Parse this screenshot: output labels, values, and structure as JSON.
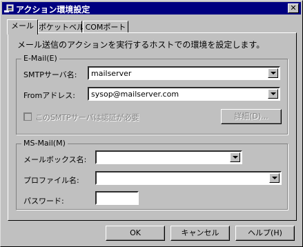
{
  "window": {
    "title": "アクション環境設定",
    "close_glyph": "✕"
  },
  "tabs": [
    {
      "label": "メール",
      "active": true
    },
    {
      "label": "ポケットベル",
      "active": false
    },
    {
      "label": "COMポート",
      "active": false
    }
  ],
  "description": "メール送信のアクションを実行するホストでの環境を設定します。",
  "email_group": {
    "legend": "E-Mail(E)",
    "smtp_label": "SMTPサーバ名:",
    "smtp_value": "mailserver",
    "from_label": "Fromアドレス:",
    "from_value": "sysop@mailserver.com",
    "auth_label": "このSMTPサーバは認証が必要",
    "auth_checked": false,
    "details_button": "詳細(D)..."
  },
  "msmail_group": {
    "legend": "MS-Mail(M)",
    "mailbox_label": "メールボックス名:",
    "mailbox_value": "",
    "profile_label": "プロファイル名:",
    "profile_value": "",
    "password_label": "パスワード:",
    "password_value": ""
  },
  "buttons": {
    "ok": "OK",
    "cancel": "キャンセル",
    "help": "ヘルプ(H)"
  },
  "colors": {
    "titlebar": "#000080",
    "face": "#c0c0c0",
    "disabled_text": "#808080"
  }
}
